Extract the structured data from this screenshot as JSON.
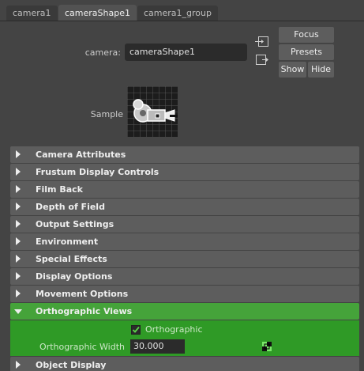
{
  "tabs": [
    {
      "label": "camera1",
      "active": false
    },
    {
      "label": "cameraShape1",
      "active": true
    },
    {
      "label": "camera1_group",
      "active": false
    }
  ],
  "camera": {
    "label": "camera:",
    "value": "cameraShape1"
  },
  "buttons": {
    "focus": "Focus",
    "presets": "Presets",
    "show": "Show",
    "hide": "Hide"
  },
  "sample": {
    "label": "Sample"
  },
  "sections": [
    {
      "label": "Camera Attributes",
      "expanded": false
    },
    {
      "label": "Frustum Display Controls",
      "expanded": false
    },
    {
      "label": "Film Back",
      "expanded": false
    },
    {
      "label": "Depth of Field",
      "expanded": false
    },
    {
      "label": "Output Settings",
      "expanded": false
    },
    {
      "label": "Environment",
      "expanded": false
    },
    {
      "label": "Special Effects",
      "expanded": false
    },
    {
      "label": "Display Options",
      "expanded": false
    },
    {
      "label": "Movement Options",
      "expanded": false
    },
    {
      "label": "Orthographic Views",
      "expanded": true
    },
    {
      "label": "Object Display",
      "expanded": false
    }
  ],
  "orthographic": {
    "checkbox_label": "Orthographic",
    "checked": true,
    "width_label": "Orthographic Width",
    "width_value": "30.000"
  },
  "colors": {
    "background": "#444444",
    "frame": "#5d5d5d",
    "frame_open": "#45a33a",
    "frame_body": "#2f9a26",
    "field": "#2b2b2b",
    "check": "#5bd94a"
  }
}
